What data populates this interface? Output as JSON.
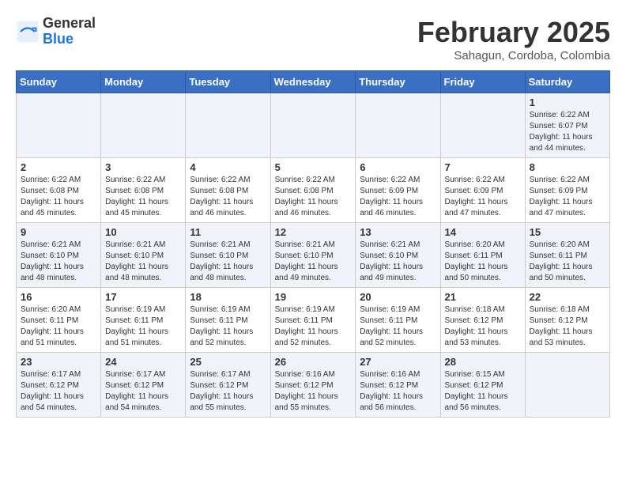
{
  "header": {
    "logo": {
      "general": "General",
      "blue": "Blue"
    },
    "title": "February 2025",
    "location": "Sahagun, Cordoba, Colombia"
  },
  "days_of_week": [
    "Sunday",
    "Monday",
    "Tuesday",
    "Wednesday",
    "Thursday",
    "Friday",
    "Saturday"
  ],
  "weeks": [
    [
      {
        "day": "",
        "info": ""
      },
      {
        "day": "",
        "info": ""
      },
      {
        "day": "",
        "info": ""
      },
      {
        "day": "",
        "info": ""
      },
      {
        "day": "",
        "info": ""
      },
      {
        "day": "",
        "info": ""
      },
      {
        "day": "1",
        "info": "Sunrise: 6:22 AM\nSunset: 6:07 PM\nDaylight: 11 hours and 44 minutes."
      }
    ],
    [
      {
        "day": "2",
        "info": "Sunrise: 6:22 AM\nSunset: 6:08 PM\nDaylight: 11 hours and 45 minutes."
      },
      {
        "day": "3",
        "info": "Sunrise: 6:22 AM\nSunset: 6:08 PM\nDaylight: 11 hours and 45 minutes."
      },
      {
        "day": "4",
        "info": "Sunrise: 6:22 AM\nSunset: 6:08 PM\nDaylight: 11 hours and 46 minutes."
      },
      {
        "day": "5",
        "info": "Sunrise: 6:22 AM\nSunset: 6:08 PM\nDaylight: 11 hours and 46 minutes."
      },
      {
        "day": "6",
        "info": "Sunrise: 6:22 AM\nSunset: 6:09 PM\nDaylight: 11 hours and 46 minutes."
      },
      {
        "day": "7",
        "info": "Sunrise: 6:22 AM\nSunset: 6:09 PM\nDaylight: 11 hours and 47 minutes."
      },
      {
        "day": "8",
        "info": "Sunrise: 6:22 AM\nSunset: 6:09 PM\nDaylight: 11 hours and 47 minutes."
      }
    ],
    [
      {
        "day": "9",
        "info": "Sunrise: 6:21 AM\nSunset: 6:10 PM\nDaylight: 11 hours and 48 minutes."
      },
      {
        "day": "10",
        "info": "Sunrise: 6:21 AM\nSunset: 6:10 PM\nDaylight: 11 hours and 48 minutes."
      },
      {
        "day": "11",
        "info": "Sunrise: 6:21 AM\nSunset: 6:10 PM\nDaylight: 11 hours and 48 minutes."
      },
      {
        "day": "12",
        "info": "Sunrise: 6:21 AM\nSunset: 6:10 PM\nDaylight: 11 hours and 49 minutes."
      },
      {
        "day": "13",
        "info": "Sunrise: 6:21 AM\nSunset: 6:10 PM\nDaylight: 11 hours and 49 minutes."
      },
      {
        "day": "14",
        "info": "Sunrise: 6:20 AM\nSunset: 6:11 PM\nDaylight: 11 hours and 50 minutes."
      },
      {
        "day": "15",
        "info": "Sunrise: 6:20 AM\nSunset: 6:11 PM\nDaylight: 11 hours and 50 minutes."
      }
    ],
    [
      {
        "day": "16",
        "info": "Sunrise: 6:20 AM\nSunset: 6:11 PM\nDaylight: 11 hours and 51 minutes."
      },
      {
        "day": "17",
        "info": "Sunrise: 6:19 AM\nSunset: 6:11 PM\nDaylight: 11 hours and 51 minutes."
      },
      {
        "day": "18",
        "info": "Sunrise: 6:19 AM\nSunset: 6:11 PM\nDaylight: 11 hours and 52 minutes."
      },
      {
        "day": "19",
        "info": "Sunrise: 6:19 AM\nSunset: 6:11 PM\nDaylight: 11 hours and 52 minutes."
      },
      {
        "day": "20",
        "info": "Sunrise: 6:19 AM\nSunset: 6:11 PM\nDaylight: 11 hours and 52 minutes."
      },
      {
        "day": "21",
        "info": "Sunrise: 6:18 AM\nSunset: 6:12 PM\nDaylight: 11 hours and 53 minutes."
      },
      {
        "day": "22",
        "info": "Sunrise: 6:18 AM\nSunset: 6:12 PM\nDaylight: 11 hours and 53 minutes."
      }
    ],
    [
      {
        "day": "23",
        "info": "Sunrise: 6:17 AM\nSunset: 6:12 PM\nDaylight: 11 hours and 54 minutes."
      },
      {
        "day": "24",
        "info": "Sunrise: 6:17 AM\nSunset: 6:12 PM\nDaylight: 11 hours and 54 minutes."
      },
      {
        "day": "25",
        "info": "Sunrise: 6:17 AM\nSunset: 6:12 PM\nDaylight: 11 hours and 55 minutes."
      },
      {
        "day": "26",
        "info": "Sunrise: 6:16 AM\nSunset: 6:12 PM\nDaylight: 11 hours and 55 minutes."
      },
      {
        "day": "27",
        "info": "Sunrise: 6:16 AM\nSunset: 6:12 PM\nDaylight: 11 hours and 56 minutes."
      },
      {
        "day": "28",
        "info": "Sunrise: 6:15 AM\nSunset: 6:12 PM\nDaylight: 11 hours and 56 minutes."
      },
      {
        "day": "",
        "info": ""
      }
    ]
  ]
}
